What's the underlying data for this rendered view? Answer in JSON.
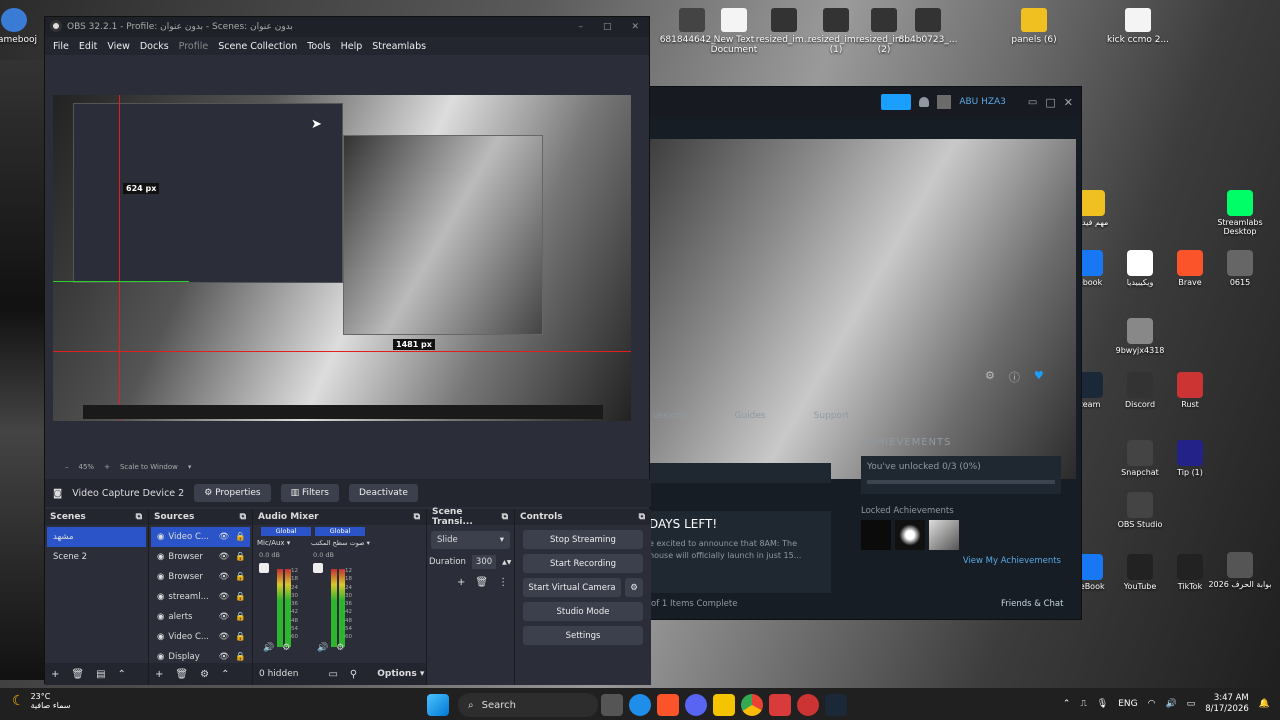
{
  "desktop": {
    "icons_top": [
      {
        "label": "681844642_..."
      },
      {
        "label": "New Text Document"
      },
      {
        "label": "resized_im..."
      },
      {
        "label": "resized_im... (1)"
      },
      {
        "label": "resized_im... (2)"
      },
      {
        "label": "8b4b0723_..."
      },
      {
        "label": "panels (6)"
      },
      {
        "label": "kick ccmo 2..."
      }
    ],
    "icons_right": [
      {
        "label": "مهم فيديو"
      },
      {
        "label": "Streamlabs Desktop"
      },
      {
        "label": "ebook"
      },
      {
        "label": "ويكيبيديا"
      },
      {
        "label": "Brave"
      },
      {
        "label": "0615"
      },
      {
        "label": "9bwyjx4318"
      },
      {
        "label": "team"
      },
      {
        "label": "Discord"
      },
      {
        "label": "Rust"
      },
      {
        "label": "Snapchat"
      },
      {
        "label": "Tip (1)"
      },
      {
        "label": "OBS Studio"
      },
      {
        "label": "ceBook"
      },
      {
        "label": "YouTube"
      },
      {
        "label": "TikTok"
      },
      {
        "label": "بوابة الحرف 2026"
      }
    ],
    "left_icon": {
      "label": "Gamebooj"
    }
  },
  "steam": {
    "user": "ABU HZA3",
    "tabs": [
      "ussions",
      "Guides",
      "Support"
    ],
    "achievements_title": "ACHIEVEMENTS",
    "unlocked": "You've unlocked 0/3 (0%)",
    "unlocked_fraction": 0,
    "locked_title": "Locked Achievements",
    "view_link": "View My Achievements",
    "days_left": "DAYS LEFT!",
    "news_line1": "e excited to announce that 8AM: The",
    "news_line2": "house will officially launch in just 15...",
    "items_complete": "of 1 Items Complete",
    "friends": "Friends & Chat"
  },
  "obs": {
    "title": "OBS 32.2.1 - Profile: بدون عنوان - Scenes: بدون عنوان",
    "menu": [
      "File",
      "Edit",
      "View",
      "Docks",
      "Profile",
      "Scene Collection",
      "Tools",
      "Help",
      "Streamlabs"
    ],
    "preview": {
      "label1": "624 px",
      "label2": "1481 px"
    },
    "zoom": {
      "value": "45%",
      "mode": "Scale to Window"
    },
    "source_bar": {
      "source_name": "Video Capture Device 2",
      "properties": "Properties",
      "filters": "Filters",
      "deactivate": "Deactivate"
    },
    "scenes": {
      "title": "Scenes",
      "items": [
        {
          "name": "مشهد",
          "selected": true
        },
        {
          "name": "Scene 2",
          "selected": false
        }
      ]
    },
    "sources": {
      "title": "Sources",
      "items": [
        "Video C...",
        "Browser",
        "Browser",
        "streaml...",
        "alerts",
        "Video C...",
        "Display"
      ]
    },
    "mixer": {
      "title": "Audio Mixer",
      "channels": [
        {
          "tag": "Global",
          "name": "Mic/Aux",
          "db": "0.0 dB"
        },
        {
          "tag": "Global",
          "name": "صوت سطح المكتب",
          "db": "0.0 dB"
        }
      ],
      "scale": [
        "-12",
        "-18",
        "-24",
        "-30",
        "-36",
        "-42",
        "-48",
        "-54",
        "-60"
      ],
      "hidden": "0 hidden",
      "options": "Options"
    },
    "transitions": {
      "title": "Scene Transi...",
      "type": "Slide",
      "duration_label": "Duration",
      "duration": "300"
    },
    "controls": {
      "title": "Controls",
      "buttons": [
        "Stop Streaming",
        "Start Recording",
        "Start Virtual Camera",
        "Studio Mode",
        "Settings"
      ]
    }
  },
  "taskbar": {
    "weather_temp": "23°C",
    "weather_desc": "سماء صافية",
    "search": "Search",
    "lang": "ENG",
    "time": "3:47 AM",
    "date": "8/17/2026"
  }
}
